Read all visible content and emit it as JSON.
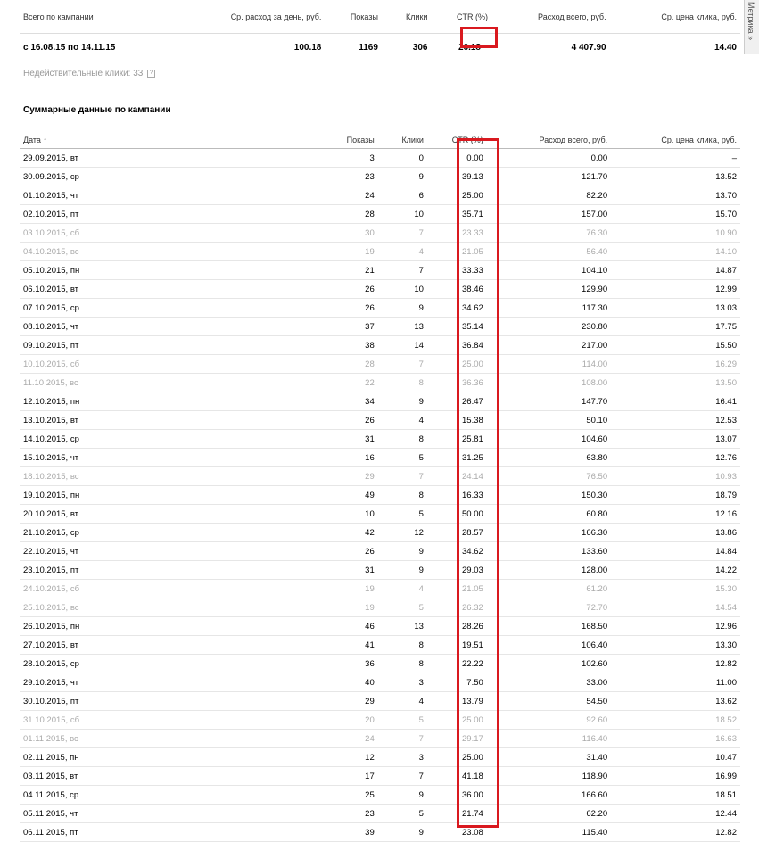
{
  "summary": {
    "headers": [
      "Всего по кампании",
      "Ср. расход за день, руб.",
      "Показы",
      "Клики",
      "CTR (%)",
      "Расход всего, руб.",
      "Ср. цена клика, руб."
    ],
    "period": "с 16.08.15 по 14.11.15",
    "avg_daily_spend": "100.18",
    "shows": "1169",
    "clicks": "306",
    "ctr": "26.18",
    "total_spend": "4 407.90",
    "avg_cpc": "14.40"
  },
  "invalid_clicks": "Недействительные клики: 33",
  "help_icon": "?",
  "section_title": "Суммарные данные по кампании",
  "table": {
    "headers": [
      "Дата ↑",
      "Показы",
      "Клики",
      "CTR (%)",
      "Расход всего, руб.",
      "Ср. цена клика, руб."
    ],
    "rows": [
      {
        "date": "29.09.2015, вт",
        "shows": "3",
        "clicks": "0",
        "ctr": "0.00",
        "spend": "0.00",
        "cpc": "–",
        "weekend": false
      },
      {
        "date": "30.09.2015, ср",
        "shows": "23",
        "clicks": "9",
        "ctr": "39.13",
        "spend": "121.70",
        "cpc": "13.52",
        "weekend": false
      },
      {
        "date": "01.10.2015, чт",
        "shows": "24",
        "clicks": "6",
        "ctr": "25.00",
        "spend": "82.20",
        "cpc": "13.70",
        "weekend": false
      },
      {
        "date": "02.10.2015, пт",
        "shows": "28",
        "clicks": "10",
        "ctr": "35.71",
        "spend": "157.00",
        "cpc": "15.70",
        "weekend": false
      },
      {
        "date": "03.10.2015, сб",
        "shows": "30",
        "clicks": "7",
        "ctr": "23.33",
        "spend": "76.30",
        "cpc": "10.90",
        "weekend": true
      },
      {
        "date": "04.10.2015, вс",
        "shows": "19",
        "clicks": "4",
        "ctr": "21.05",
        "spend": "56.40",
        "cpc": "14.10",
        "weekend": true
      },
      {
        "date": "05.10.2015, пн",
        "shows": "21",
        "clicks": "7",
        "ctr": "33.33",
        "spend": "104.10",
        "cpc": "14.87",
        "weekend": false
      },
      {
        "date": "06.10.2015, вт",
        "shows": "26",
        "clicks": "10",
        "ctr": "38.46",
        "spend": "129.90",
        "cpc": "12.99",
        "weekend": false
      },
      {
        "date": "07.10.2015, ср",
        "shows": "26",
        "clicks": "9",
        "ctr": "34.62",
        "spend": "117.30",
        "cpc": "13.03",
        "weekend": false
      },
      {
        "date": "08.10.2015, чт",
        "shows": "37",
        "clicks": "13",
        "ctr": "35.14",
        "spend": "230.80",
        "cpc": "17.75",
        "weekend": false
      },
      {
        "date": "09.10.2015, пт",
        "shows": "38",
        "clicks": "14",
        "ctr": "36.84",
        "spend": "217.00",
        "cpc": "15.50",
        "weekend": false
      },
      {
        "date": "10.10.2015, сб",
        "shows": "28",
        "clicks": "7",
        "ctr": "25.00",
        "spend": "114.00",
        "cpc": "16.29",
        "weekend": true
      },
      {
        "date": "11.10.2015, вс",
        "shows": "22",
        "clicks": "8",
        "ctr": "36.36",
        "spend": "108.00",
        "cpc": "13.50",
        "weekend": true
      },
      {
        "date": "12.10.2015, пн",
        "shows": "34",
        "clicks": "9",
        "ctr": "26.47",
        "spend": "147.70",
        "cpc": "16.41",
        "weekend": false
      },
      {
        "date": "13.10.2015, вт",
        "shows": "26",
        "clicks": "4",
        "ctr": "15.38",
        "spend": "50.10",
        "cpc": "12.53",
        "weekend": false
      },
      {
        "date": "14.10.2015, ср",
        "shows": "31",
        "clicks": "8",
        "ctr": "25.81",
        "spend": "104.60",
        "cpc": "13.07",
        "weekend": false
      },
      {
        "date": "15.10.2015, чт",
        "shows": "16",
        "clicks": "5",
        "ctr": "31.25",
        "spend": "63.80",
        "cpc": "12.76",
        "weekend": false
      },
      {
        "date": "18.10.2015, вс",
        "shows": "29",
        "clicks": "7",
        "ctr": "24.14",
        "spend": "76.50",
        "cpc": "10.93",
        "weekend": true
      },
      {
        "date": "19.10.2015, пн",
        "shows": "49",
        "clicks": "8",
        "ctr": "16.33",
        "spend": "150.30",
        "cpc": "18.79",
        "weekend": false
      },
      {
        "date": "20.10.2015, вт",
        "shows": "10",
        "clicks": "5",
        "ctr": "50.00",
        "spend": "60.80",
        "cpc": "12.16",
        "weekend": false
      },
      {
        "date": "21.10.2015, ср",
        "shows": "42",
        "clicks": "12",
        "ctr": "28.57",
        "spend": "166.30",
        "cpc": "13.86",
        "weekend": false
      },
      {
        "date": "22.10.2015, чт",
        "shows": "26",
        "clicks": "9",
        "ctr": "34.62",
        "spend": "133.60",
        "cpc": "14.84",
        "weekend": false
      },
      {
        "date": "23.10.2015, пт",
        "shows": "31",
        "clicks": "9",
        "ctr": "29.03",
        "spend": "128.00",
        "cpc": "14.22",
        "weekend": false
      },
      {
        "date": "24.10.2015, сб",
        "shows": "19",
        "clicks": "4",
        "ctr": "21.05",
        "spend": "61.20",
        "cpc": "15.30",
        "weekend": true
      },
      {
        "date": "25.10.2015, вс",
        "shows": "19",
        "clicks": "5",
        "ctr": "26.32",
        "spend": "72.70",
        "cpc": "14.54",
        "weekend": true
      },
      {
        "date": "26.10.2015, пн",
        "shows": "46",
        "clicks": "13",
        "ctr": "28.26",
        "spend": "168.50",
        "cpc": "12.96",
        "weekend": false
      },
      {
        "date": "27.10.2015, вт",
        "shows": "41",
        "clicks": "8",
        "ctr": "19.51",
        "spend": "106.40",
        "cpc": "13.30",
        "weekend": false
      },
      {
        "date": "28.10.2015, ср",
        "shows": "36",
        "clicks": "8",
        "ctr": "22.22",
        "spend": "102.60",
        "cpc": "12.82",
        "weekend": false
      },
      {
        "date": "29.10.2015, чт",
        "shows": "40",
        "clicks": "3",
        "ctr": "7.50",
        "spend": "33.00",
        "cpc": "11.00",
        "weekend": false
      },
      {
        "date": "30.10.2015, пт",
        "shows": "29",
        "clicks": "4",
        "ctr": "13.79",
        "spend": "54.50",
        "cpc": "13.62",
        "weekend": false
      },
      {
        "date": "31.10.2015, сб",
        "shows": "20",
        "clicks": "5",
        "ctr": "25.00",
        "spend": "92.60",
        "cpc": "18.52",
        "weekend": true
      },
      {
        "date": "01.11.2015, вс",
        "shows": "24",
        "clicks": "7",
        "ctr": "29.17",
        "spend": "116.40",
        "cpc": "16.63",
        "weekend": true
      },
      {
        "date": "02.11.2015, пн",
        "shows": "12",
        "clicks": "3",
        "ctr": "25.00",
        "spend": "31.40",
        "cpc": "10.47",
        "weekend": false
      },
      {
        "date": "03.11.2015, вт",
        "shows": "17",
        "clicks": "7",
        "ctr": "41.18",
        "spend": "118.90",
        "cpc": "16.99",
        "weekend": false
      },
      {
        "date": "04.11.2015, ср",
        "shows": "25",
        "clicks": "9",
        "ctr": "36.00",
        "spend": "166.60",
        "cpc": "18.51",
        "weekend": false
      },
      {
        "date": "05.11.2015, чт",
        "shows": "23",
        "clicks": "5",
        "ctr": "21.74",
        "spend": "62.20",
        "cpc": "12.44",
        "weekend": false
      },
      {
        "date": "06.11.2015, пт",
        "shows": "39",
        "clicks": "9",
        "ctr": "23.08",
        "spend": "115.40",
        "cpc": "12.82",
        "weekend": false
      }
    ]
  },
  "metrika_tab": "Метрика »",
  "colors": {
    "highlight": "#d9191f",
    "weekend_text": "#aaaaaa"
  }
}
